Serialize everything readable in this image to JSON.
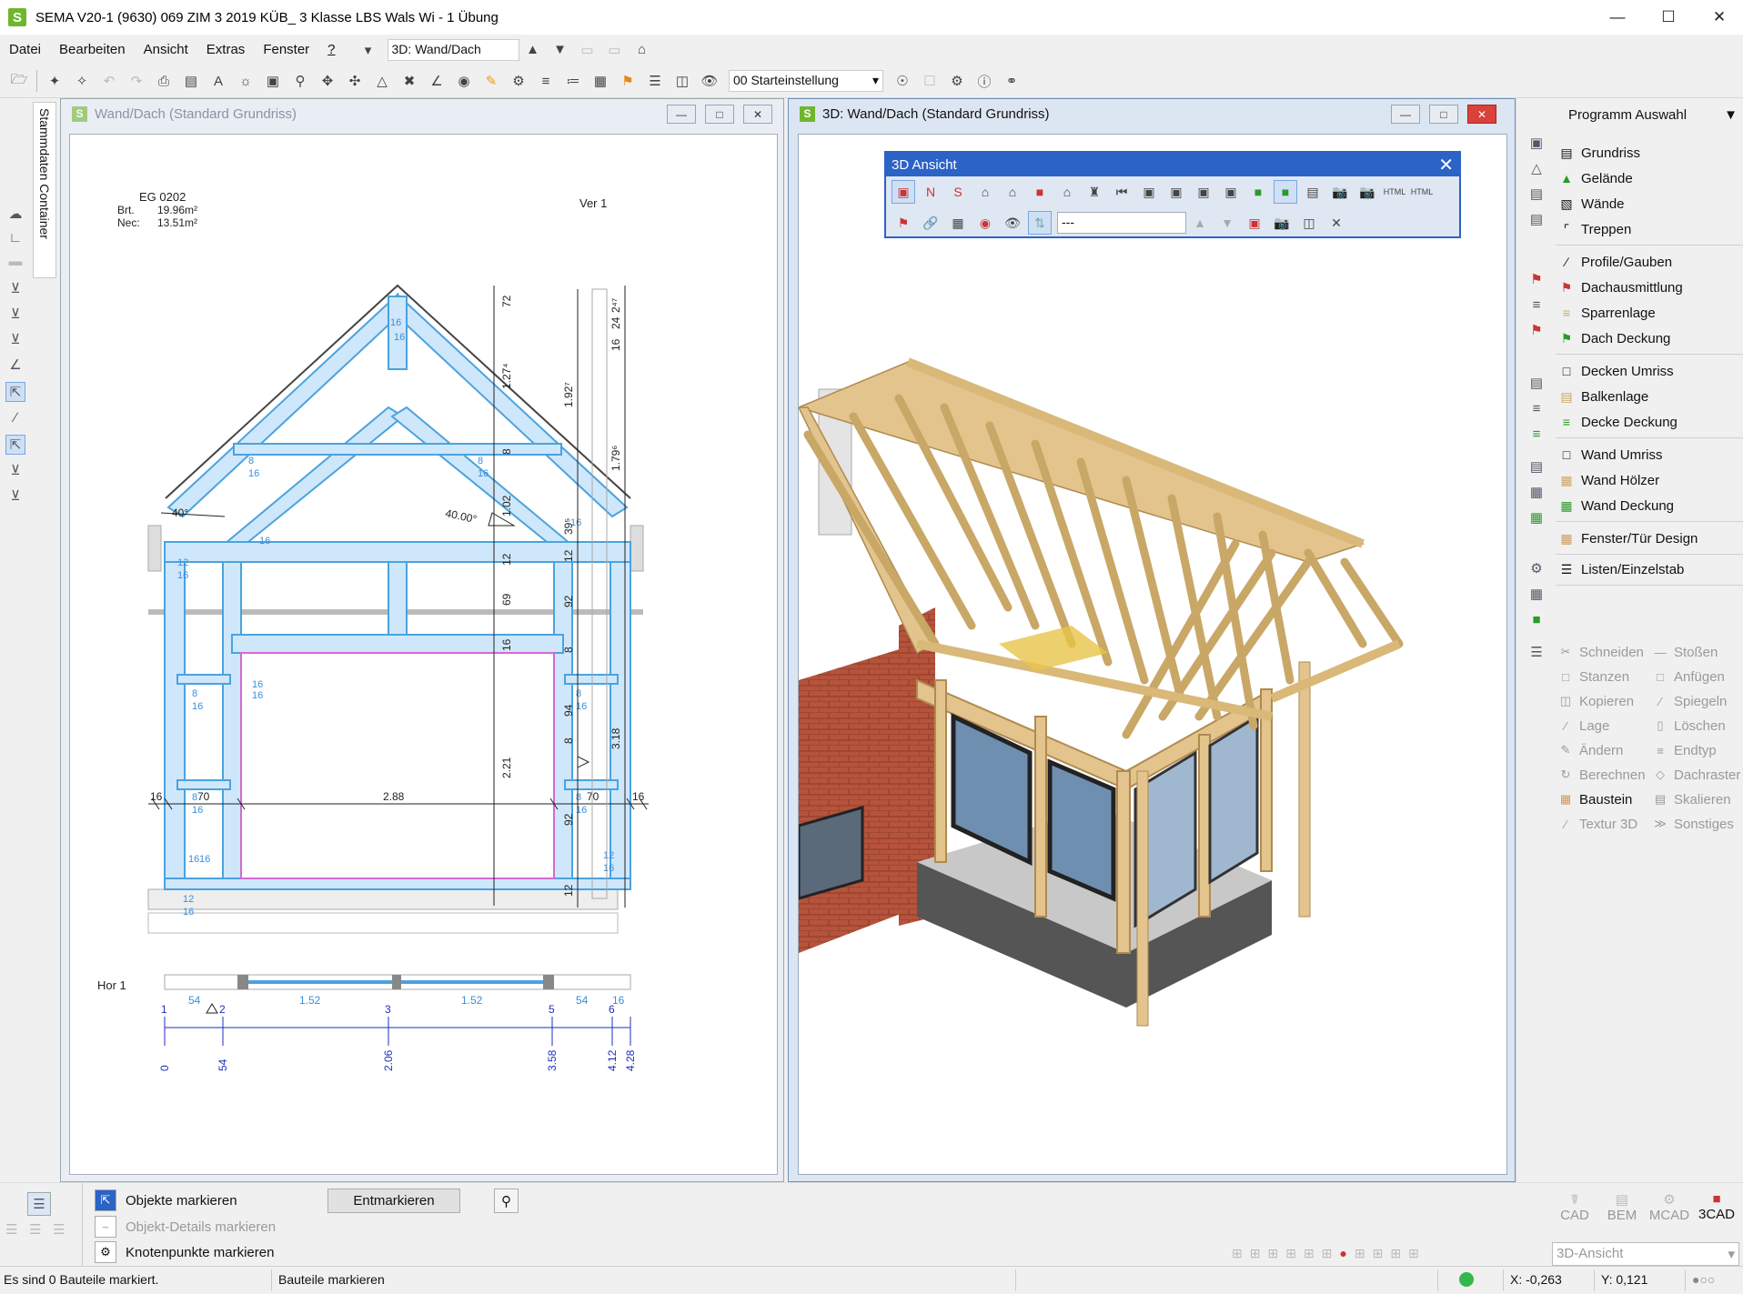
{
  "window": {
    "title": "SEMA V20-1 (9630) 069 ZIM 3 2019 KÜB_ 3 Klasse LBS Wals Wi - 1 Übung",
    "app_icon": "S"
  },
  "menu": {
    "items": [
      "Datei",
      "Bearbeiten",
      "Ansicht",
      "Extras",
      "Fenster",
      "?"
    ],
    "window_select": "3D: Wand/Dach"
  },
  "toolbar": {
    "preset_select": "00 Starteinstellung"
  },
  "left_panel": {
    "container_tab": "Stammdaten Container"
  },
  "drawing_window": {
    "title": "Wand/Dach (Standard Grundriss)",
    "room": {
      "name": "EG 0202",
      "brt_label": "Brt.",
      "brt_value": "19.96m²",
      "nec_label": "Nec:",
      "nec_value": "13.51m²"
    },
    "ver_label": "Ver 1",
    "hor_label": "Hor 1",
    "dims": {
      "roof_left": "40°",
      "roof_right": "40.00°",
      "span": "2.88",
      "left_w": "70",
      "right_w": "70",
      "edge_l": "16",
      "edge_r": "16",
      "height_inner": "2.21",
      "vchain": [
        "72",
        "1.27⁴",
        "8",
        "1.02",
        "12",
        "69",
        "16"
      ],
      "vright": [
        "1.92⁷",
        "39⁵",
        "12",
        "92",
        "8",
        "94",
        "8",
        "92",
        "12"
      ],
      "vright2": [
        "2⁴⁷",
        "16",
        "24",
        "1.79⁶",
        "3.18"
      ],
      "member_labels": [
        "16",
        "16",
        "8",
        "16",
        "8",
        "16",
        "16",
        "16",
        "12",
        "16",
        "16",
        "16",
        "8",
        "16",
        "8",
        "16",
        "8",
        "16",
        "8",
        "16",
        "16",
        "16",
        "12",
        "16",
        "12",
        "16"
      ],
      "hor_dims": [
        "54",
        "1.52",
        "1.52",
        "54",
        "16"
      ],
      "hor_points": [
        "1",
        "2",
        "3",
        "5",
        "6"
      ],
      "hor_values": [
        "0",
        "54",
        "2.06",
        "3.58",
        "4.12",
        "4.28"
      ]
    }
  },
  "window_3d": {
    "title": "3D: Wand/Dach (Standard Grundriss)"
  },
  "toolbar_3d": {
    "title": "3D Ansicht",
    "input_value": "---",
    "html_label": "HTML"
  },
  "program_panel": {
    "title": "Programm Auswahl",
    "groups": [
      [
        {
          "label": "Grundriss",
          "icon": "floorplan-icon"
        },
        {
          "label": "Gelände",
          "icon": "terrain-icon"
        },
        {
          "label": "Wände",
          "icon": "wall-icon"
        },
        {
          "label": "Treppen",
          "icon": "stairs-icon"
        }
      ],
      [
        {
          "label": "Profile/Gauben",
          "icon": "profile-icon"
        },
        {
          "label": "Dachausmittlung",
          "icon": "roof-icon"
        },
        {
          "label": "Sparrenlage",
          "icon": "rafter-icon"
        },
        {
          "label": "Dach Deckung",
          "icon": "roof-cover-icon"
        }
      ],
      [
        {
          "label": "Decken Umriss",
          "icon": "ceiling-icon"
        },
        {
          "label": "Balkenlage",
          "icon": "beam-icon"
        },
        {
          "label": "Decke Deckung",
          "icon": "ceiling-cover-icon"
        }
      ],
      [
        {
          "label": "Wand Umriss",
          "icon": "wall-outline-icon"
        },
        {
          "label": "Wand Hölzer",
          "icon": "wall-timber-icon"
        },
        {
          "label": "Wand Deckung",
          "icon": "wall-cover-icon"
        }
      ],
      [
        {
          "label": "Fenster/Tür Design",
          "icon": "window-door-icon"
        }
      ],
      [
        {
          "label": "Listen/Einzelstab",
          "icon": "list-icon"
        }
      ]
    ],
    "edit_commands": [
      [
        "Schneiden",
        "Stoßen"
      ],
      [
        "Stanzen",
        "Anfügen"
      ],
      [
        "Kopieren",
        "Spiegeln"
      ],
      [
        "Lage",
        "Löschen"
      ],
      [
        "Ändern",
        "Endtyp"
      ],
      [
        "Berechnen",
        "Dachraster"
      ],
      [
        "Baustein",
        "Skalieren"
      ],
      [
        "Textur 3D",
        "Sonstiges"
      ]
    ]
  },
  "bottom_panel": {
    "options": [
      "Objekte markieren",
      "Objekt-Details markieren",
      "Knotenpunkte markieren"
    ],
    "unmark_button": "Entmarkieren",
    "modes": [
      "CAD",
      "BEM",
      "MCAD",
      "3CAD"
    ],
    "view_select": "3D-Ansicht"
  },
  "status": {
    "message": "Es sind 0 Bauteile markiert.",
    "mode": "Bauteile markieren",
    "x": "X: -0,263",
    "y": "Y: 0,121"
  },
  "colors": {
    "accent": "#2b63c6",
    "app_green": "#6fb62c",
    "timber_blue": "#4aa3df",
    "brick": "#b5533c",
    "wood": "#e3c48c"
  }
}
